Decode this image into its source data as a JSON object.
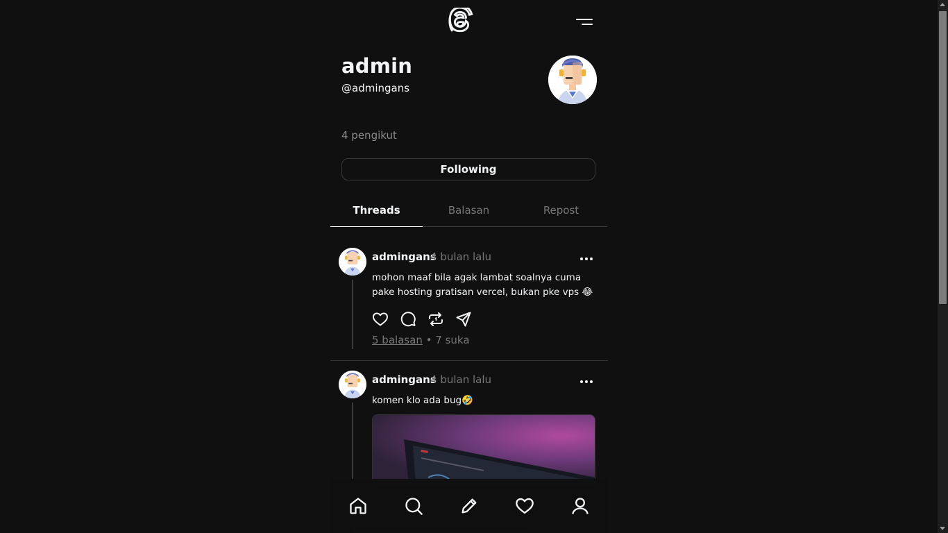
{
  "profile": {
    "name": "admin",
    "handle": "@admingans",
    "followers": "4 pengikut",
    "follow_button": "Following"
  },
  "tabs": [
    {
      "label": "Threads",
      "active": true
    },
    {
      "label": "Balasan",
      "active": false
    },
    {
      "label": "Repost",
      "active": false
    }
  ],
  "posts": [
    {
      "user": "admingans",
      "time": "4 bulan lalu",
      "text": "mohon maaf bila agak lambat soalnya cuma pake hosting gratisan vercel, bukan pke vps 😂",
      "replies": "5 balasan",
      "likes": "• 7 suka"
    },
    {
      "user": "admingans",
      "time": "4 bulan lalu",
      "text": "komen klo ada bug🤣"
    }
  ],
  "icons": {
    "logo": "threads-logo-icon",
    "menu": "menu-icon",
    "like": "heart-icon",
    "comment": "comment-icon",
    "repost": "repost-icon",
    "share": "send-icon",
    "more": "more-icon",
    "nav": [
      "home-icon",
      "search-icon",
      "edit-icon",
      "heart-icon",
      "user-icon"
    ]
  },
  "colors": {
    "background": "#101010",
    "text": "#f3f5f7",
    "muted": "#777777"
  }
}
